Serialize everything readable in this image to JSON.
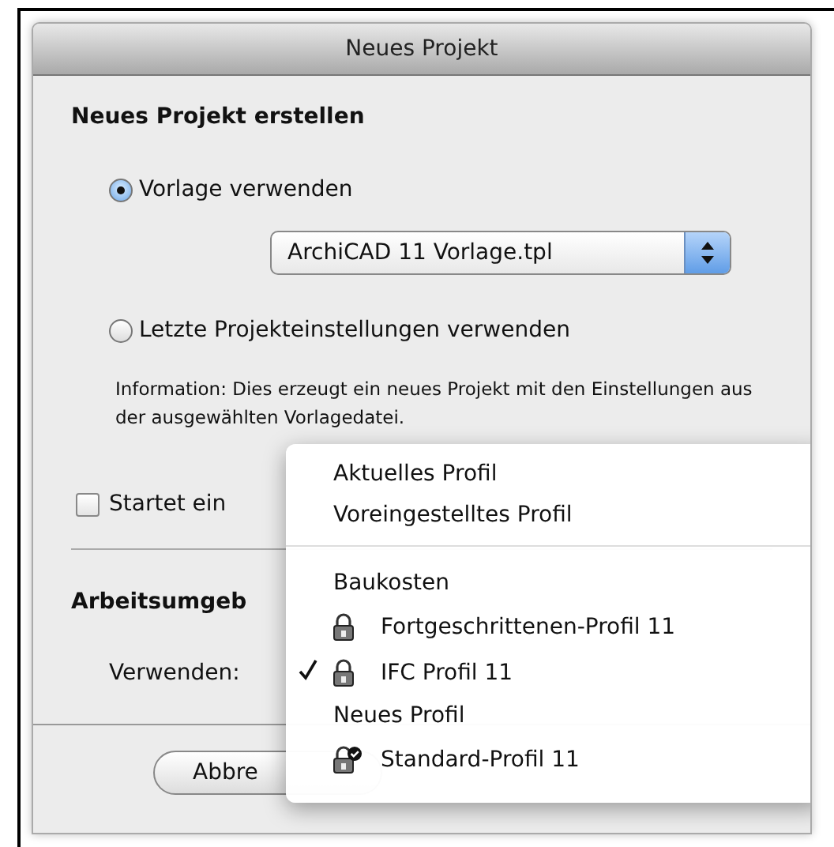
{
  "window": {
    "title": "Neues Projekt"
  },
  "create_section": {
    "heading": "Neues Projekt erstellen",
    "options": [
      {
        "label": "Vorlage verwenden",
        "selected": true
      },
      {
        "label": "Letzte Projekteinstellungen verwenden",
        "selected": false
      }
    ],
    "template_popup": {
      "value": "ArchiCAD 11 Vorlage.tpl"
    },
    "info": "Information: Dies erzeugt ein neues Projekt mit den Einstellungen aus der ausgewählten Vorlagedatei."
  },
  "start_checkbox": {
    "label": "Startet ein",
    "checked": false
  },
  "environment_section": {
    "heading": "Arbeitsumgeb",
    "use_label": "Verwenden:"
  },
  "buttons": [
    "Abbre"
  ],
  "profile_menu": {
    "items": [
      {
        "kind": "plain",
        "label": "Aktuelles Profil",
        "selected": false
      },
      {
        "kind": "plain",
        "label": "Voreingestelltes Profil",
        "selected": false
      },
      {
        "kind": "separator"
      },
      {
        "kind": "plain",
        "label": "Baukosten",
        "selected": false
      },
      {
        "kind": "locked",
        "label": "Fortgeschrittenen-Profil 11",
        "selected": false
      },
      {
        "kind": "locked",
        "label": "IFC Profil 11",
        "selected": true
      },
      {
        "kind": "plain",
        "label": "Neues Profil",
        "selected": false
      },
      {
        "kind": "locked-default",
        "label": "Standard-Profil 11",
        "selected": false
      }
    ]
  }
}
